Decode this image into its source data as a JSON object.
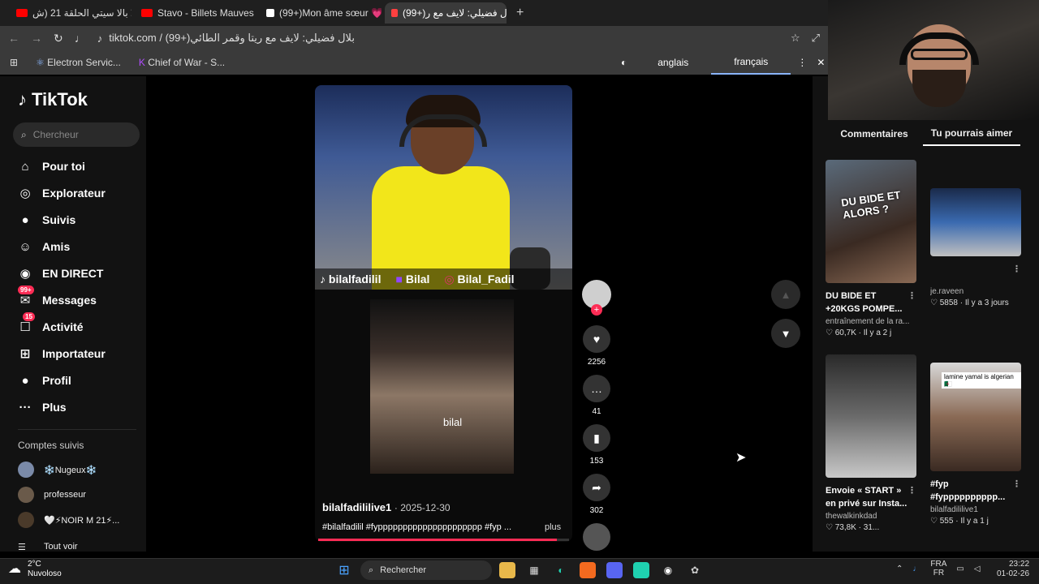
{
  "browser": {
    "tabs": [
      {
        "label": "شالا بالا سيتي الحلقة 21 (ش...",
        "color": "#ff0000"
      },
      {
        "label": "Stavo - Billets Mauves fe...",
        "color": "#ff0000"
      },
      {
        "label": "(99+)Mon âme sœur 💗",
        "color": "#ffffff"
      },
      {
        "label": "(99+)بلال فضيلي: لايف مع ر...",
        "color": "#ff4040"
      }
    ],
    "new_tab": "+",
    "url": "tiktok.com / (99+)بلال فضيلي: لايف مع ريتا وقمر الطائي",
    "bookmarks": [
      "Electron Servic...",
      "Chief of War - S..."
    ],
    "translate": {
      "options": [
        "anglais",
        "français"
      ],
      "selected": "français"
    }
  },
  "tiktok": {
    "logo": "TikTok",
    "search_placeholder": "Chercheur",
    "menu": [
      {
        "icon": "home-icon",
        "glyph": "⌂",
        "label": "Pour toi"
      },
      {
        "icon": "compass-icon",
        "glyph": "◎",
        "label": "Explorateur"
      },
      {
        "icon": "following-icon",
        "glyph": "●",
        "label": "Suivis"
      },
      {
        "icon": "friends-icon",
        "glyph": "☺",
        "label": "Amis"
      },
      {
        "icon": "live-icon",
        "glyph": "◉",
        "label": "EN DIRECT"
      },
      {
        "icon": "messages-icon",
        "glyph": "✉",
        "label": "Messages",
        "badge": "99+"
      },
      {
        "icon": "activity-icon",
        "glyph": "☐",
        "label": "Activité",
        "badge": "15"
      },
      {
        "icon": "upload-icon",
        "glyph": "⊞",
        "label": "Importateur"
      },
      {
        "icon": "profile-icon",
        "glyph": "●",
        "label": "Profil"
      },
      {
        "icon": "more-icon",
        "glyph": "···",
        "label": "Plus"
      }
    ],
    "following_title": "Comptes suivis",
    "following": [
      "❄️Nugeux❄️",
      "professeur",
      "🤍⚡NOIR M 21⚡..."
    ],
    "see_all": "Tout voir"
  },
  "video": {
    "handle_tiktok": "bilalfadilil",
    "handle_twitch": "Bilal",
    "handle_instagram": "Bilal_Fadil",
    "overlay_text": "bilal",
    "author": "bilalfadililive1",
    "date": "· 2025-12-30",
    "tags": "#bilalfadilil #fyppppppppppppppppppppp #fyp ...",
    "more": "plus",
    "progress": 0.95,
    "likes": "2256",
    "comments": "41",
    "saves": "153",
    "shares": "302"
  },
  "right_panel": {
    "tabs": [
      "Commentaires",
      "Tu pourrais aimer"
    ],
    "selected_tab": "Tu pourrais aimer",
    "cards": [
      {
        "thumb_text": "DU BIDE ET ALORS ?",
        "title": "DU BIDE ET +20KGS POMPE...",
        "author": "entraînement de la ra...",
        "likes": "60,7K",
        "time": "· Il y a 2 j"
      },
      {
        "thumb_text": "",
        "title": "",
        "author": "je.raveen",
        "likes": "5858",
        "time": "· Il y a 3 jours"
      },
      {
        "thumb_text": "",
        "title": "Envoie « START » en privé sur Insta...",
        "author": "thewalkinkdad",
        "likes": "73,8K",
        "time": "· 31..."
      },
      {
        "thumb_text": "lamine yamal is algerian 🇩🇿",
        "title": "#fyp #fypppppppppp...",
        "author": "bilalfadililive1",
        "likes": "555",
        "time": "· Il y a 1 j"
      }
    ]
  },
  "taskbar": {
    "weather_temp": "2°C",
    "weather_desc": "Nuvoloso",
    "search": "Rechercher",
    "lang_top": "FRA",
    "lang_bottom": "FR",
    "time": "23:22",
    "date": "01-02-26"
  },
  "colors": {
    "accent": "#fe2c55",
    "translate_underline": "#8ab4f8"
  }
}
